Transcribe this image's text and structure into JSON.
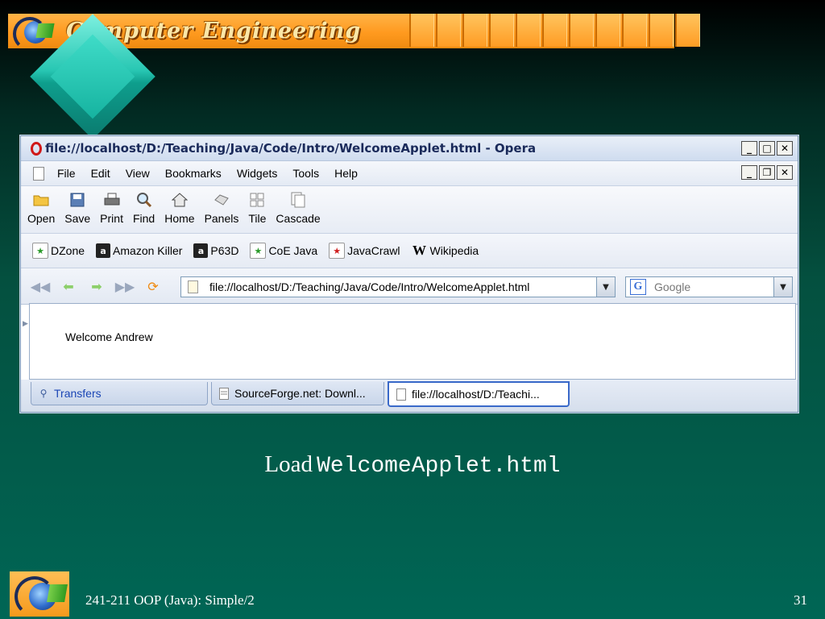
{
  "slide": {
    "banner_title": "Computer Engineering",
    "caption_prefix": "Load",
    "caption_code": "WelcomeApplet.html",
    "footer_text": "241-211 OOP (Java): Simple/2",
    "page_number": "31"
  },
  "browser": {
    "title": "file://localhost/D:/Teaching/Java/Code/Intro/WelcomeApplet.html - Opera",
    "window_buttons": [
      "minimize-icon",
      "maximize-icon",
      "close-icon"
    ],
    "menu": [
      "File",
      "Edit",
      "View",
      "Bookmarks",
      "Widgets",
      "Tools",
      "Help"
    ],
    "toolbar": [
      {
        "label": "Open",
        "icon": "folder-icon"
      },
      {
        "label": "Save",
        "icon": "disk-icon"
      },
      {
        "label": "Print",
        "icon": "printer-icon"
      },
      {
        "label": "Find",
        "icon": "magnifier-icon"
      },
      {
        "label": "Home",
        "icon": "home-icon"
      },
      {
        "label": "Panels",
        "icon": "panels-icon"
      },
      {
        "label": "Tile",
        "icon": "tile-icon"
      },
      {
        "label": "Cascade",
        "icon": "cascade-icon"
      }
    ],
    "bookmarks": [
      {
        "label": "DZone",
        "icon": "bookmark-icon"
      },
      {
        "label": "Amazon Killer",
        "icon": "amazon-icon"
      },
      {
        "label": "P63D",
        "icon": "amazon-icon"
      },
      {
        "label": "CoE Java",
        "icon": "bookmark-icon"
      },
      {
        "label": "JavaCrawl",
        "icon": "bookmark-icon"
      },
      {
        "label": "Wikipedia",
        "icon": "wikipedia-icon"
      }
    ],
    "address": "file://localhost/D:/Teaching/Java/Code/Intro/WelcomeApplet.html",
    "search_placeholder": "Google",
    "page_content": "Welcome Andrew",
    "tabs": [
      {
        "label": "Transfers",
        "active": false
      },
      {
        "label": "SourceForge.net: Downl...",
        "active": false
      },
      {
        "label": "file://localhost/D:/Teachi...",
        "active": true
      }
    ]
  }
}
